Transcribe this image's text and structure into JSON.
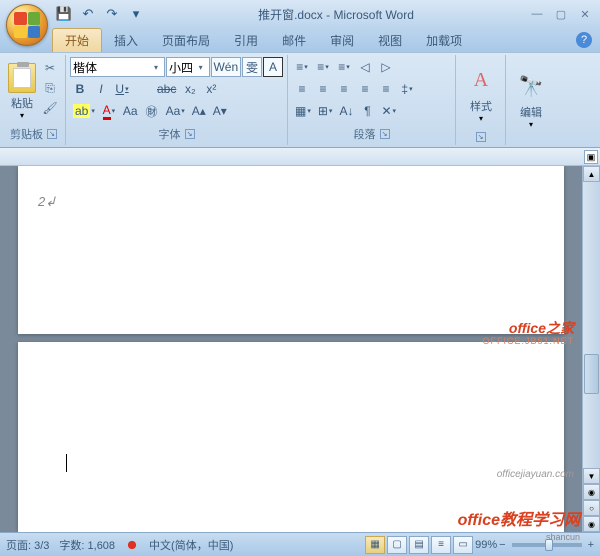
{
  "title": "推开窗.docx - Microsoft Word",
  "qat": {
    "save": "💾",
    "undo": "↶",
    "redo": "↷",
    "more": "▾"
  },
  "win": {
    "min": "—",
    "max": "▢",
    "close": "✕"
  },
  "tabs": {
    "items": [
      "开始",
      "插入",
      "页面布局",
      "引用",
      "邮件",
      "审阅",
      "视图",
      "加载项"
    ],
    "active": 0,
    "help": "?"
  },
  "ribbon": {
    "clipboard": {
      "label": "剪贴板",
      "paste": "粘贴",
      "cut": "✂",
      "copy": "⎘",
      "fmt_painter": "🖌"
    },
    "font": {
      "label": "字体",
      "family": "楷体",
      "size": "小四",
      "clear_fmt": "Wén",
      "phonetic": "雯",
      "char_border": "A",
      "bold": "B",
      "italic": "I",
      "underline": "U",
      "strike": "abc",
      "subscript": "x₂",
      "superscript": "x²",
      "highlight": "ab",
      "font_color": "A",
      "char_shading": "Aa",
      "enclose": "㊖",
      "change_case": "Aa",
      "grow": "A▴",
      "shrink": "A▾"
    },
    "paragraph": {
      "label": "段落",
      "bullets": "≡",
      "numbering": "≡",
      "multilevel": "≡",
      "dec_indent": "◁",
      "inc_indent": "▷",
      "align_left": "≡",
      "align_center": "≡",
      "align_right": "≡",
      "justify": "≡",
      "distribute": "≡",
      "line_spacing": "‡",
      "shading": "▦",
      "borders": "⊞",
      "sort": "A↓",
      "show_marks": "¶",
      "asian": "✕"
    },
    "styles": {
      "label": "样式",
      "change": "A"
    },
    "editing": {
      "label": "编辑",
      "find": "🔍"
    }
  },
  "document": {
    "page1_text": "2↲"
  },
  "status": {
    "page": "页面: 3/3",
    "words": "字数: 1,608",
    "lang": "中文(简体，中国)",
    "zoom": "99%",
    "zoom_minus": "−",
    "zoom_plus": "+"
  },
  "watermarks": {
    "w1": "office之家",
    "w1s": "OFFICE.JB51.NET",
    "w2": "officejiayuan.com",
    "w3": "office教程学习网",
    "w4": "shancun"
  }
}
